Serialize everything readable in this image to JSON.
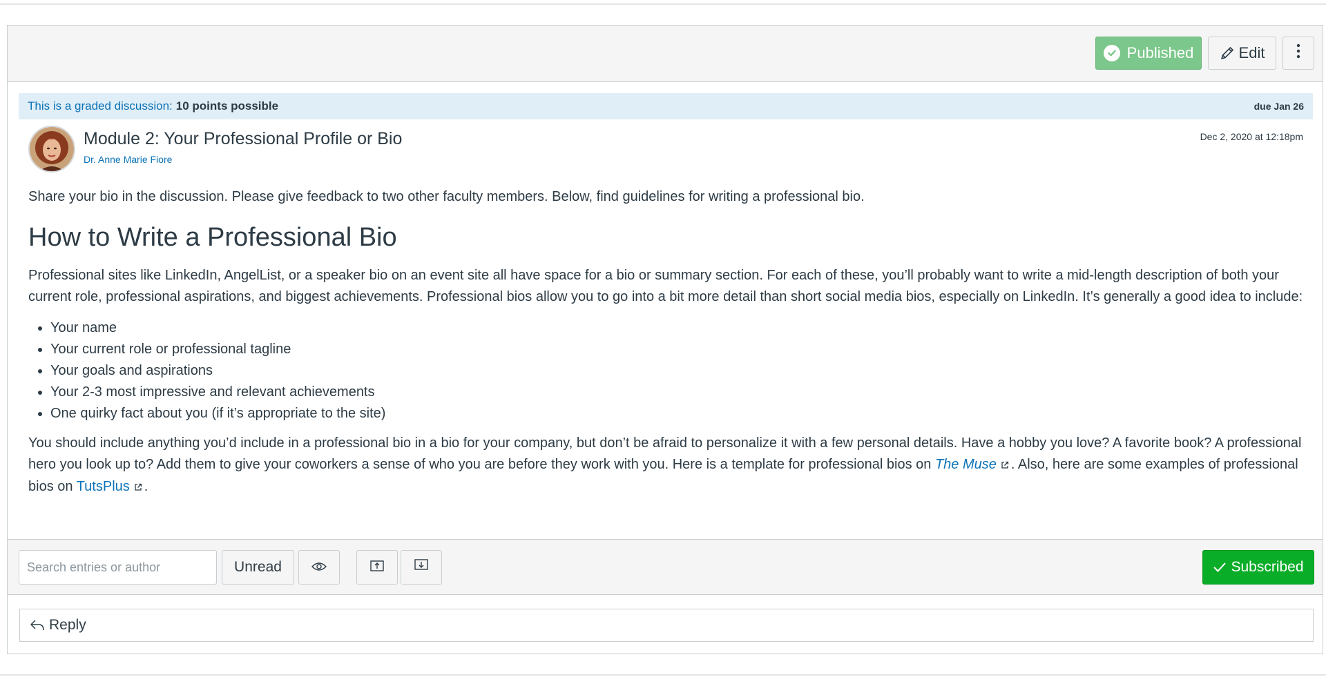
{
  "toolbar": {
    "published_label": "Published",
    "edit_label": "Edit"
  },
  "banner": {
    "graded_text": "This is a graded discussion:",
    "points_text": "10 points possible",
    "due_text": "due Jan 26"
  },
  "post": {
    "title": "Module 2: Your Professional Profile or Bio",
    "author": "Dr. Anne Marie Fiore",
    "date": "Dec 2, 2020 at 12:18pm",
    "intro": "Share your bio in the discussion. Please give feedback to two other faculty members. Below, find guidelines for writing a professional bio.",
    "heading": "How to Write a Professional Bio",
    "paragraph1": "Professional sites like LinkedIn, AngelList, or a speaker bio on an event site all have space for a bio or summary section. For each of these, you’ll probably want to write a mid-length description of both your current role, professional aspirations, and biggest achievements. Professional bios allow you to go into a bit more detail than short social media bios, especially on LinkedIn. It’s generally a good idea to include:",
    "list": [
      "Your name",
      "Your current role or professional tagline",
      "Your goals and aspirations",
      "Your 2-3 most impressive and relevant achievements",
      "One quirky fact about you (if it’s appropriate to the site)"
    ],
    "paragraph2_start": "You should include anything you’d include in a professional bio in a bio for your company, but don’t be afraid to personalize it with a few personal details. Have a hobby you love? A favorite book? A professional hero you look up to? Add them to give your coworkers a sense of who you are before they work with you. Here is a template for professional bios on",
    "link1": "The Muse",
    "paragraph2_mid": ". Also, here are some examples of professional bios on",
    "link2": "TutsPlus",
    "paragraph2_end": "."
  },
  "footer": {
    "search_placeholder": "Search entries or author",
    "unread_label": "Unread",
    "subscribed_label": "Subscribed"
  },
  "reply": {
    "label": "Reply"
  },
  "icons": {
    "published": "check-circle-icon",
    "edit": "pencil-icon",
    "more": "kebab-menu-icon",
    "eye": "eye-icon",
    "expand": "collapse-up-icon",
    "collapse": "expand-down-icon",
    "subscribed": "check-icon",
    "reply": "reply-arrow-icon",
    "external": "external-link-icon"
  },
  "colors": {
    "published_bg": "#7cc78b",
    "subscribed_bg": "#0aad28",
    "link": "#0b73b7",
    "banner_bg": "#e0eef7"
  }
}
